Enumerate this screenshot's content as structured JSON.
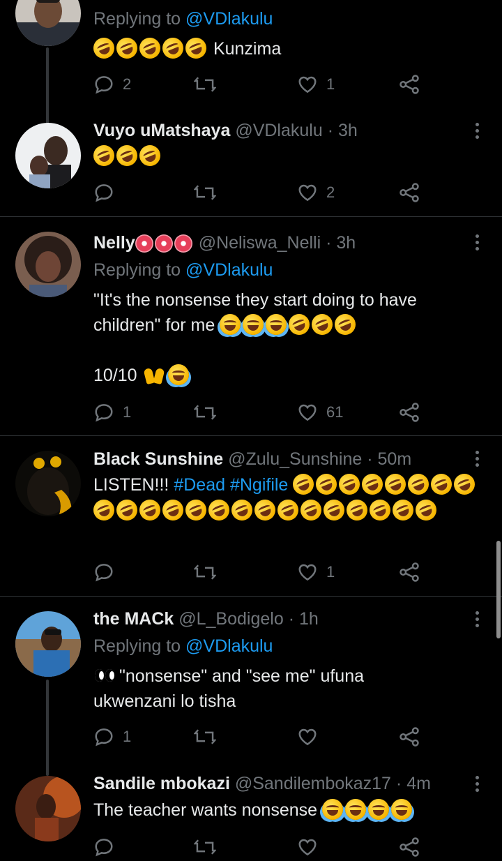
{
  "tweets": [
    {
      "reply_to_prefix": "Replying to ",
      "reply_to_handle": "@VDlakulu",
      "text": "Kunzima",
      "stats": {
        "replies": "2",
        "retweets": "",
        "likes": "1"
      }
    },
    {
      "name": "Vuyo uMatshaya",
      "handle": "@VDlakulu",
      "time": "3h",
      "stats": {
        "replies": "",
        "retweets": "",
        "likes": "2"
      }
    },
    {
      "name": "Nelly",
      "handle": "@Neliswa_Nelli",
      "time": "3h",
      "reply_to_prefix": "Replying to ",
      "reply_to_handle": "@VDlakulu",
      "text_line1": "\"It's the nonsense they start doing to have",
      "text_line2": "children\" for me",
      "text_line3": "10/10",
      "stats": {
        "replies": "1",
        "retweets": "",
        "likes": "61"
      }
    },
    {
      "name": "Black Sunshine",
      "handle": "@Zulu_Sunshine",
      "time": "50m",
      "text": "LISTEN!!!",
      "hashtag1": "#Dead",
      "hashtag2": "#Ngifile",
      "stats": {
        "replies": "",
        "retweets": "",
        "likes": "1"
      }
    },
    {
      "name": "the MACk",
      "handle": "@L_Bodigelo",
      "time": "1h",
      "reply_to_prefix": "Replying to ",
      "reply_to_handle": "@VDlakulu",
      "text_line1": "\"nonsense\" and \"see me\" ufuna",
      "text_line2": "ukwenzani lo tisha",
      "stats": {
        "replies": "1",
        "retweets": "",
        "likes": ""
      }
    },
    {
      "name": "Sandile mbokazi",
      "handle": "@Sandilembokaz17",
      "time": "4m",
      "text": "The teacher wants nonsense"
    }
  ],
  "separator": "·",
  "icons": {
    "reply": "reply-icon",
    "retweet": "retweet-icon",
    "like": "heart-icon",
    "share": "share-icon",
    "more": "more-icon"
  },
  "colors": {
    "background": "#000000",
    "text": "#e7e9ea",
    "muted": "#71767b",
    "link": "#1d9bf0",
    "divider": "#2f3336"
  }
}
